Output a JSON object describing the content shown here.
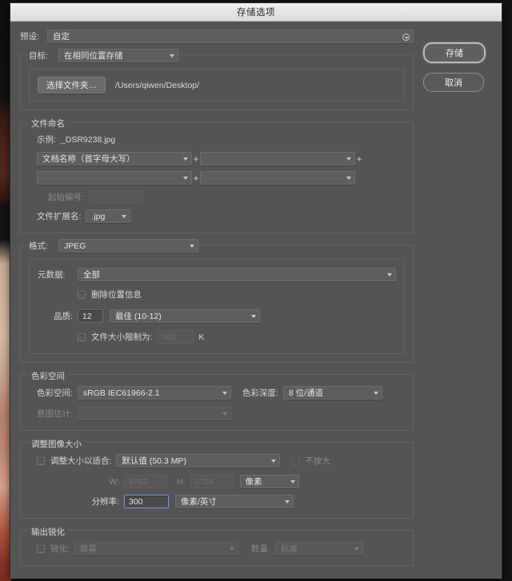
{
  "window": {
    "title": "存储选项"
  },
  "preset": {
    "label": "预设:",
    "value": "自定"
  },
  "actions": {
    "save": "存储",
    "cancel": "取消"
  },
  "target": {
    "label": "目标:",
    "value": "在相同位置存储",
    "choose_folder_button": "选择文件夹…",
    "path": "/Users/qiwen/Desktop/"
  },
  "file_naming": {
    "title": "文件命名",
    "example_label": "示例:",
    "example_value": "_DSR9238.jpg",
    "token1": "文档名称（首字母大写）",
    "token2": "",
    "token3": "",
    "token4": "",
    "plus": "+",
    "start_number_label": "起始编号:",
    "start_number_value": "",
    "extension_label": "文件扩展名:",
    "extension_value": ".jpg"
  },
  "format": {
    "label": "格式:",
    "value": "JPEG",
    "metadata_label": "元数据:",
    "metadata_value": "全部",
    "remove_location_label": "删除位置信息",
    "remove_location_checked": false,
    "quality_label": "品质:",
    "quality_value": "12",
    "quality_preset": "最佳 (10-12)",
    "limit_size_label": "文件大小限制为:",
    "limit_size_checked": false,
    "limit_size_value": "500",
    "limit_size_unit": "K"
  },
  "color_space": {
    "title": "色彩空间",
    "profile_label": "色彩空间:",
    "profile_value": "sRGB IEC61966-2.1",
    "depth_label": "色彩深度:",
    "depth_value": "8 位/通道",
    "intent_label": "意图估计:",
    "intent_value": ""
  },
  "resize": {
    "title": "调整图像大小",
    "resize_to_fit_label": "调整大小以适合:",
    "resize_to_fit_checked": false,
    "fit_value": "默认值 (50.3 MP)",
    "dont_enlarge_label": "不放大",
    "dont_enlarge_checked": false,
    "width_label": "W:",
    "width_value": "8792",
    "height_label": "H:",
    "height_value": "5728",
    "dimension_unit": "像素",
    "resolution_label": "分辨率:",
    "resolution_value": "300",
    "resolution_unit": "像素/英寸"
  },
  "sharpening": {
    "title": "输出锐化",
    "sharpen_label": "锐化:",
    "sharpen_checked": false,
    "sharpen_target": "屏幕",
    "amount_label": "数量:",
    "amount_value": "标准"
  }
}
